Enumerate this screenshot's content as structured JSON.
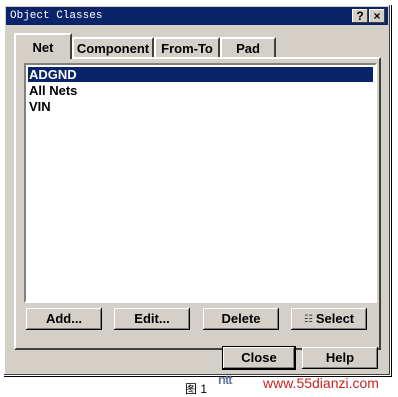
{
  "window": {
    "title": "Object Classes",
    "help_glyph": "?",
    "close_glyph": "×"
  },
  "tabs": [
    {
      "label": "Net",
      "active": true
    },
    {
      "label": "Component",
      "active": false
    },
    {
      "label": "From-To",
      "active": false
    },
    {
      "label": "Pad",
      "active": false
    }
  ],
  "list": {
    "items": [
      "ADGND",
      "All Nets",
      "VIN"
    ],
    "selected_index": 0
  },
  "actions": {
    "add": "Add...",
    "edit": "Edit...",
    "delete": "Delete",
    "select": "Select"
  },
  "footer": {
    "close": "Close",
    "help": "Help"
  },
  "caption": {
    "figure": "图 1",
    "watermark_url": "www.55dianzi.com",
    "watermark_logo": "ntt"
  },
  "colors": {
    "titlebar": "#0a246a",
    "selection": "#0a246a",
    "face": "#d4d0c8"
  }
}
